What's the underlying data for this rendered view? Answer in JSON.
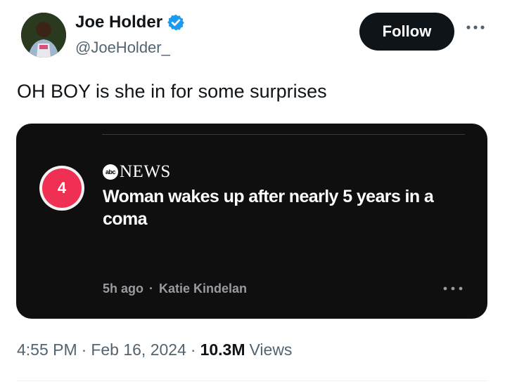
{
  "author": {
    "name": "Joe Holder",
    "handle": "@JoeHolder_",
    "verified_color": "#1d9bf0"
  },
  "follow_label": "Follow",
  "tweet_text": "OH BOY is she in for some surprises",
  "card": {
    "rank": "4",
    "source_logo": "abc",
    "source_name": "NEWS",
    "headline": "Woman wakes up after nearly 5 years in a coma",
    "time_ago": "5h ago",
    "separator": "·",
    "author": "Katie Kindelan"
  },
  "footer": {
    "time": "4:55 PM",
    "dot1": "·",
    "date": "Feb 16, 2024",
    "dot2": "·",
    "views_count": "10.3M",
    "views_label": "Views"
  },
  "colors": {
    "accent": "#1d9bf0",
    "rank_badge": "#ef2f53"
  }
}
